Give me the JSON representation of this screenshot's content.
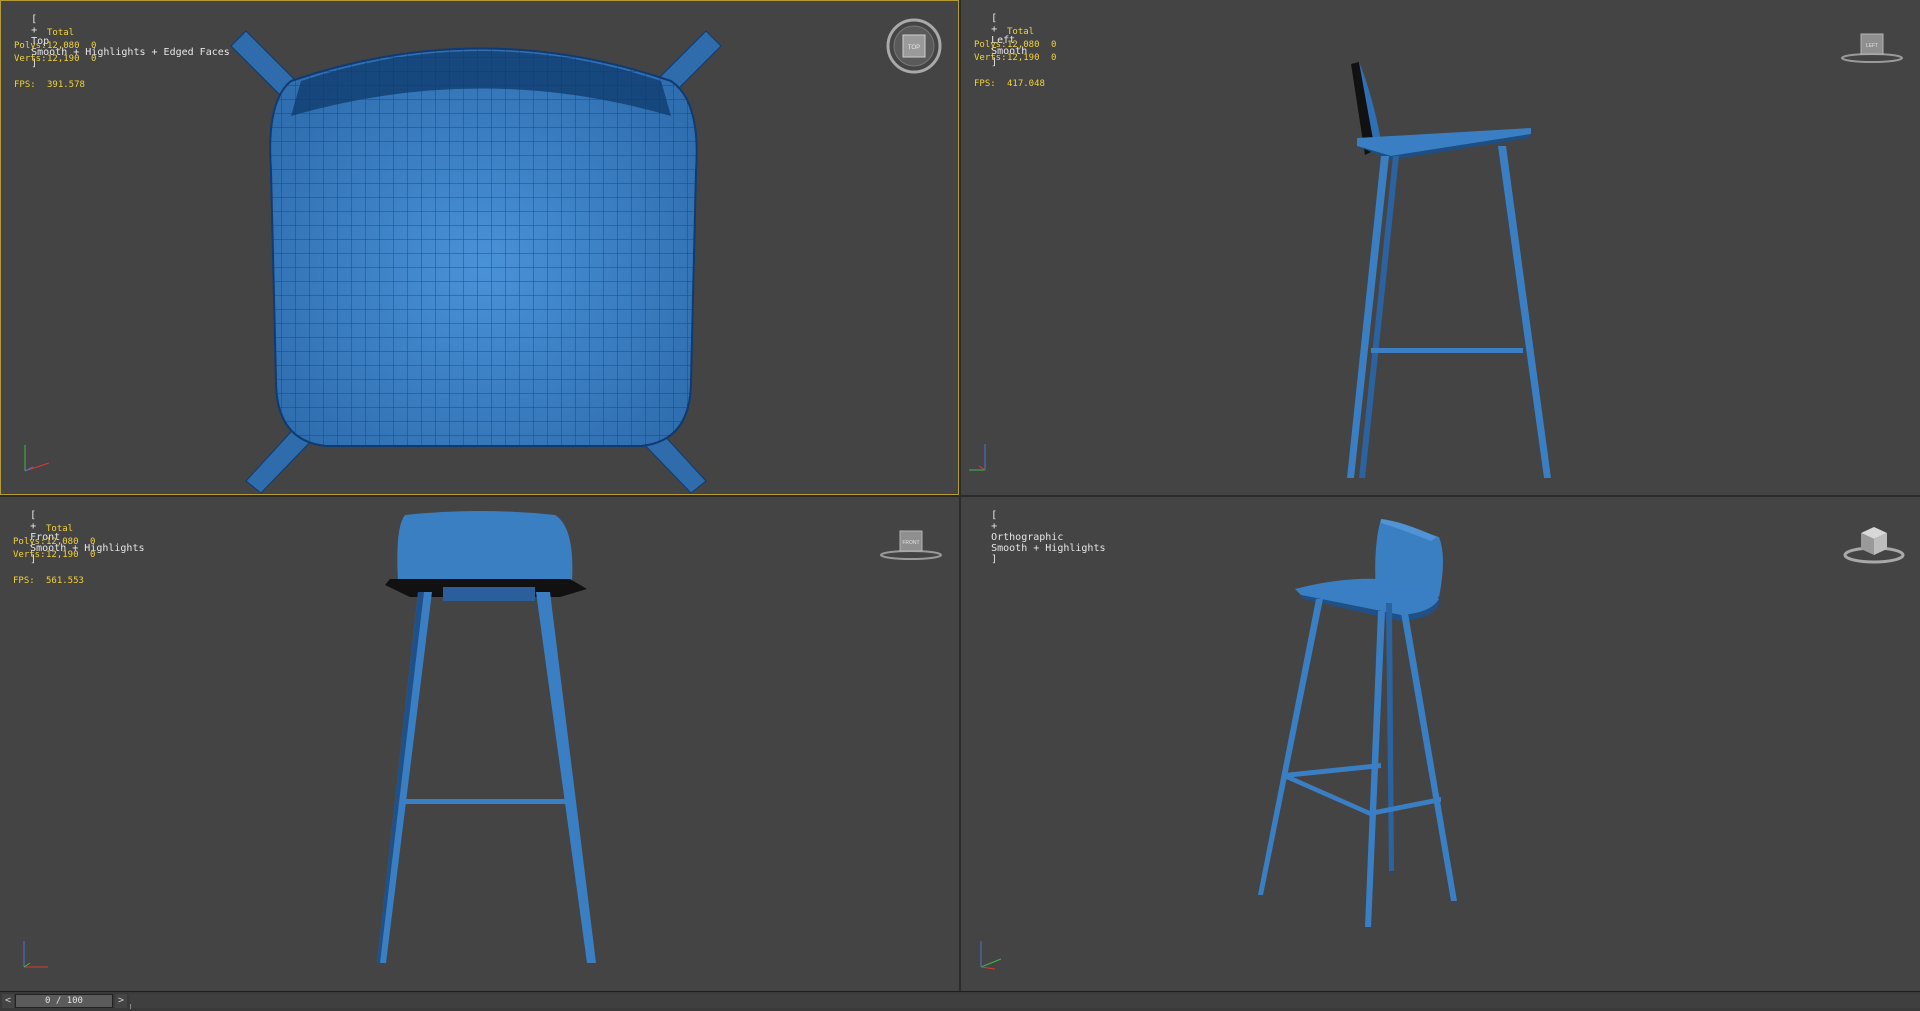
{
  "viewports": {
    "top": {
      "bracket_open": "[",
      "plus": "+",
      "view": "Top",
      "shading": "Smooth + Highlights + Edged Faces",
      "bracket_close": "]",
      "viewcube_text": "TOP",
      "stats": {
        "total_label": "Total",
        "polys_label": "Polys:",
        "polys_value": "12,080",
        "polys_sel": "0",
        "verts_label": "Verts:",
        "verts_value": "12,190",
        "verts_sel": "0",
        "fps_label": "FPS:",
        "fps_value": "391.578"
      }
    },
    "left": {
      "bracket_open": "[",
      "plus": "+",
      "view": "Left",
      "shading": "Smooth",
      "bracket_close": "]",
      "viewcube_text": "LEFT",
      "stats": {
        "total_label": "Total",
        "polys_label": "Polys:",
        "polys_value": "12,080",
        "polys_sel": "0",
        "verts_label": "Verts:",
        "verts_value": "12,190",
        "verts_sel": "0",
        "fps_label": "FPS:",
        "fps_value": "417.048"
      }
    },
    "front": {
      "bracket_open": "[",
      "plus": "+",
      "view": "Front",
      "shading": "Smooth + Highlights",
      "bracket_close": "]",
      "viewcube_text": "FRONT",
      "stats": {
        "total_label": "Total",
        "polys_label": "Polys:",
        "polys_value": "12,080",
        "polys_sel": "0",
        "verts_label": "Verts:",
        "verts_value": "12,190",
        "verts_sel": "0",
        "fps_label": "FPS:",
        "fps_value": "561.553"
      }
    },
    "perspective": {
      "bracket_open": "[",
      "plus": "+",
      "view": "Orthographic",
      "shading": "Smooth + Highlights",
      "bracket_close": "]"
    }
  },
  "timeline": {
    "prev_label": "<",
    "next_label": ">",
    "frame_display": "0 / 100"
  },
  "colors": {
    "model_blue": "#3a7fc4",
    "model_dark": "#1b4f86",
    "wire": "#0f3a73",
    "active_border": "#b39b3a",
    "stats_yellow": "#f2d338",
    "viewport_bg": "#444444"
  },
  "icons": {
    "viewcube": "viewcube-icon",
    "axis": "axis-tripod-icon"
  }
}
